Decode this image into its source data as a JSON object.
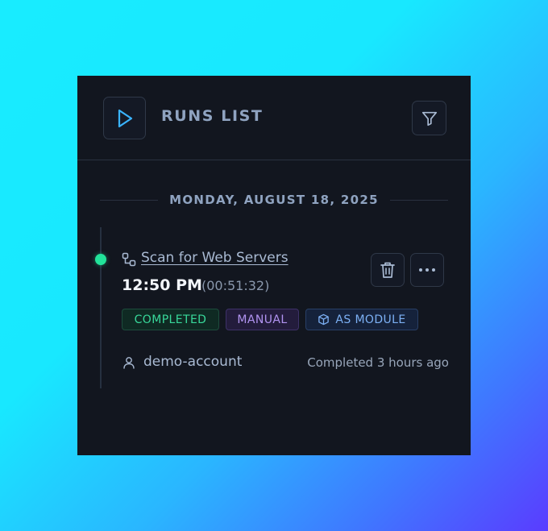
{
  "header": {
    "title": "RUNS LIST",
    "play_icon": "play-icon",
    "filter_icon": "filter-icon"
  },
  "date_group": {
    "label": "MONDAY, AUGUST 18, 2025"
  },
  "run": {
    "status_color": "#22e39a",
    "type_icon": "workflow-icon",
    "name": "Scan for Web Servers",
    "time": "12:50 PM",
    "duration": "(00:51:32)",
    "badges": {
      "status": "COMPLETED",
      "trigger": "MANUAL",
      "mode": "AS MODULE",
      "mode_icon": "cube-icon"
    },
    "user": "demo-account",
    "user_icon": "user-icon",
    "completed_ago": "Completed 3 hours ago",
    "actions": {
      "delete_icon": "trash-icon",
      "more_icon": "more-horizontal-icon"
    }
  },
  "colors": {
    "panel_bg": "#12161f",
    "accent": "#3ab4ff",
    "success": "#38d89a",
    "manual": "#b193f0",
    "module": "#7cb0f4"
  }
}
